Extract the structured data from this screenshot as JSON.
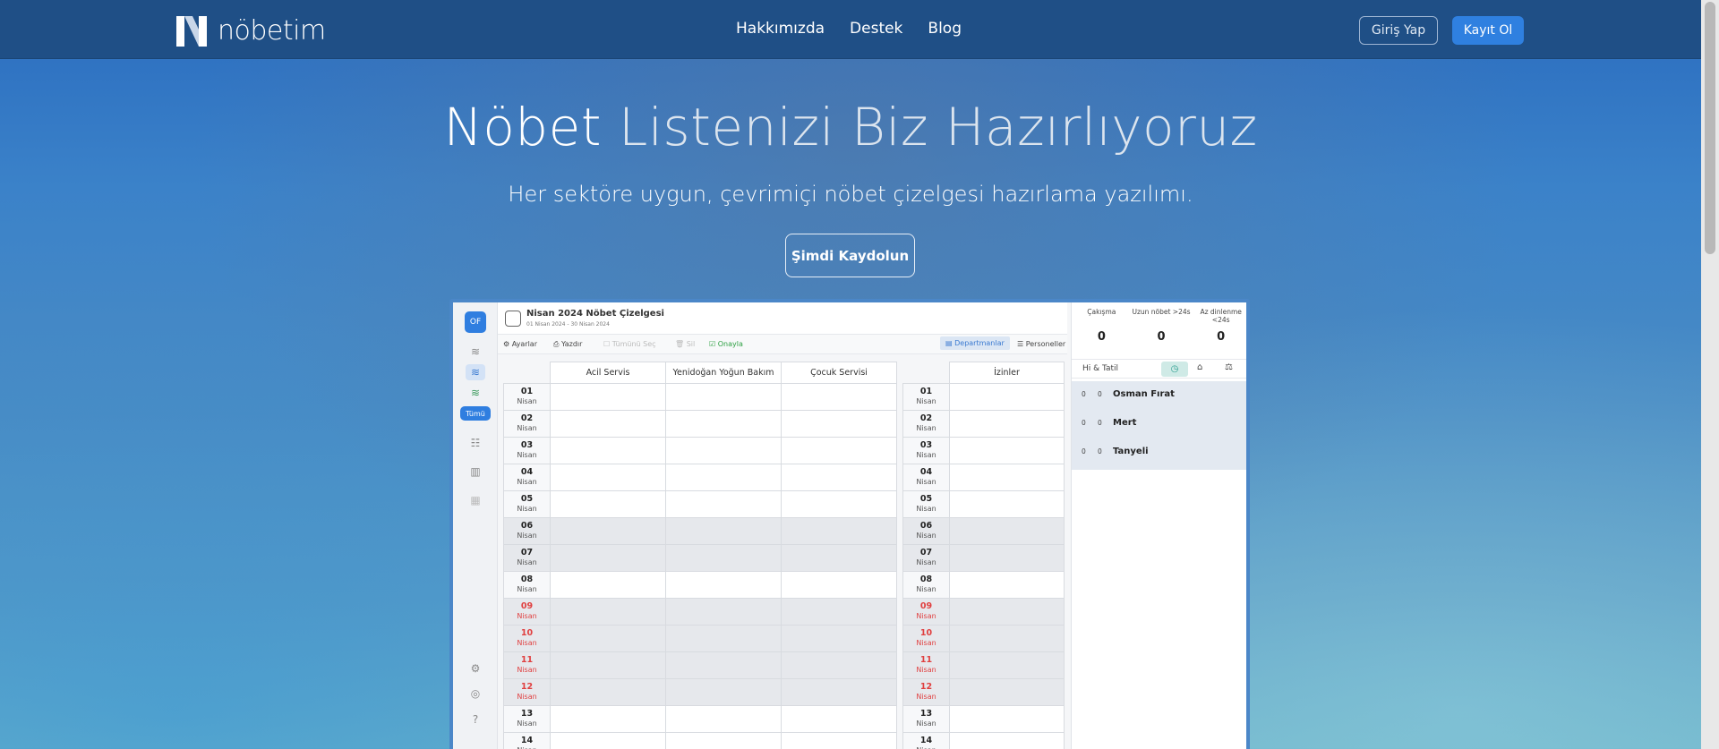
{
  "brand": {
    "name": "nöbetim"
  },
  "nav": {
    "items": [
      "Hakkımızda",
      "Destek",
      "Blog"
    ]
  },
  "auth": {
    "login": "Giriş Yap",
    "signup": "Kayıt Ol"
  },
  "hero": {
    "title_a": "Nöbet ",
    "title_b": "Listenizi Biz Hazırlıyoruz",
    "subtitle": "Her sektöre uygun, çevrimiçi nöbet çizelgesi hazırlama yazılımı.",
    "cta": "Şimdi Kaydolun"
  },
  "app": {
    "avatar": "OF",
    "filter_all": "Tümü",
    "title": "Nisan 2024 Nöbet Çizelgesi",
    "subtitle": "01 Nisan 2024 - 30 Nisan 2024",
    "toolbar": {
      "settings": "Ayarlar",
      "print": "Yazdır",
      "select_all": "Tümünü Seç",
      "delete": "Sil",
      "approve": "Onayla",
      "departments": "Departmanlar",
      "staff": "Personeller"
    },
    "columns": [
      "Acil Servis",
      "Yenidoğan Yoğun Bakım",
      "Çocuk Servisi"
    ],
    "leave_column": "İzinler",
    "month_label": "Nisan",
    "days": [
      "01",
      "02",
      "03",
      "04",
      "05",
      "06",
      "07",
      "08",
      "09",
      "10",
      "11",
      "12",
      "13",
      "14"
    ],
    "stats": [
      {
        "label": "Çakışma",
        "value": "0"
      },
      {
        "label": "Uzun nöbet >24s",
        "value": "0"
      },
      {
        "label": "Az dinlenme <24s",
        "value": "0"
      }
    ],
    "tab_label": "Hi & Tatil",
    "people": [
      {
        "a": "0",
        "b": "0",
        "name": "Osman Fırat"
      },
      {
        "a": "0",
        "b": "0",
        "name": "Mert"
      },
      {
        "a": "0",
        "b": "0",
        "name": "Tanyeli"
      }
    ]
  },
  "colors": {
    "header": "#1f4f86",
    "accent": "#2f80e0",
    "holiday": "#e04040"
  }
}
